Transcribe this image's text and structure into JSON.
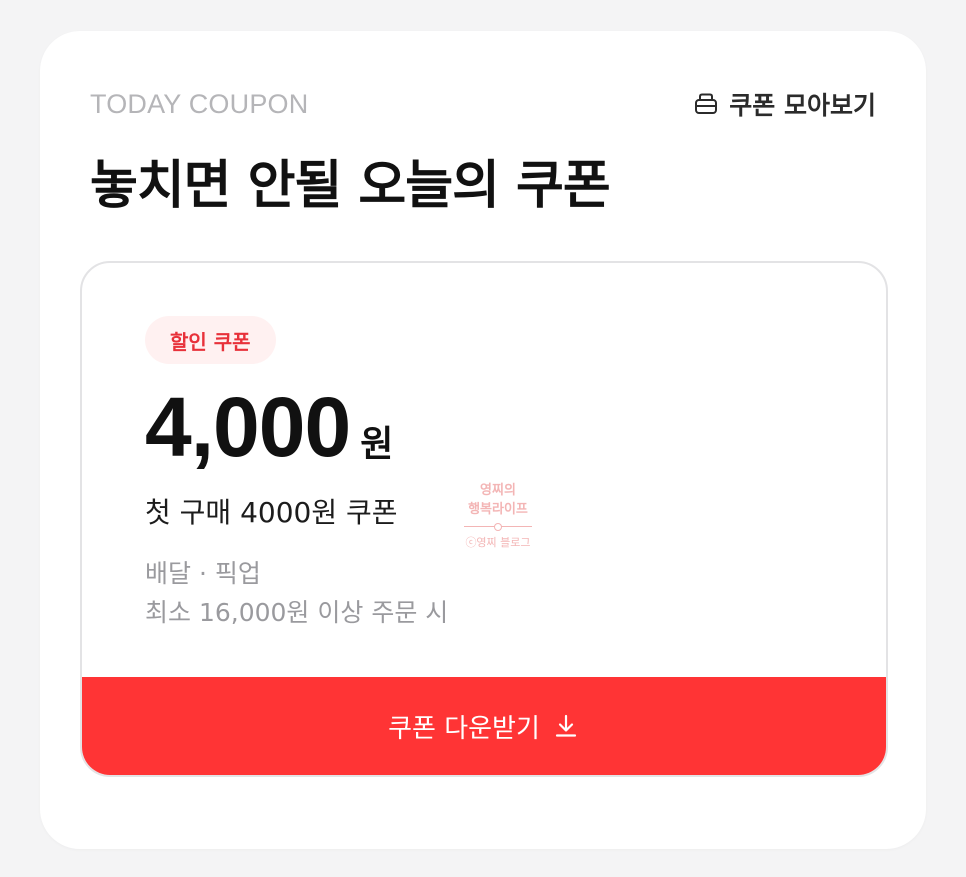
{
  "header": {
    "eyebrow": "TODAY COUPON",
    "collection_link_label": "쿠폰 모아보기",
    "collection_link_icon": "coupon-box-icon",
    "headline": "놓치면 안될 오늘의 쿠폰"
  },
  "coupon": {
    "badge": "할인 쿠폰",
    "amount": "4,000",
    "unit": "원",
    "name": "첫 구매 4000원 쿠폰",
    "conditions": [
      "배달 · 픽업",
      "최소 16,000원 이상 주문 시"
    ],
    "download_label": "쿠폰 다운받기",
    "download_icon": "download-icon"
  },
  "watermark": {
    "line1": "영찌의",
    "line2": "행복라이프",
    "line3": "ⓒ영찌 블로그"
  },
  "colors": {
    "accent": "#ff3435",
    "badge_bg": "#fff1f1",
    "badge_text": "#e8313a",
    "eyebrow": "#b5b5b8",
    "muted_text": "#9a9a9e"
  }
}
